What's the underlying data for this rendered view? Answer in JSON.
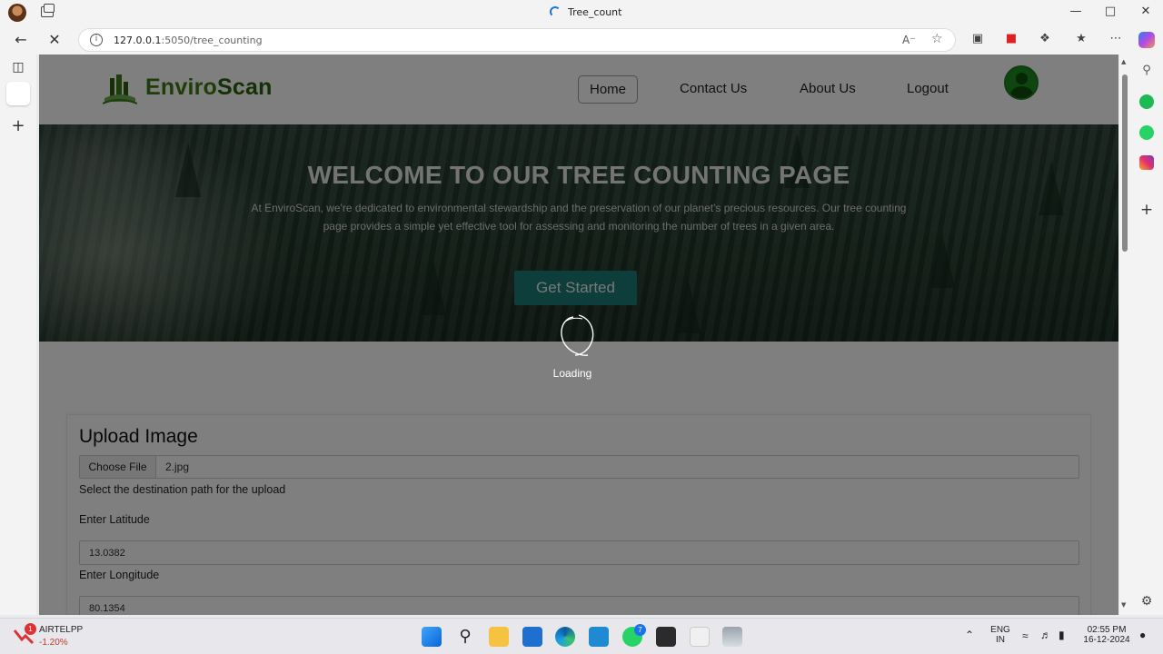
{
  "browser": {
    "tab_title": "Tree_count",
    "url_host": "127.0.0.1",
    "url_path": ":5050/tree_counting",
    "window_controls": [
      "minimize",
      "maximize",
      "close"
    ]
  },
  "site": {
    "logo_part1": "Enviro",
    "logo_part2": "Scan",
    "nav": [
      {
        "label": "Home",
        "active": true
      },
      {
        "label": "Contact Us",
        "active": false
      },
      {
        "label": "About Us",
        "active": false
      },
      {
        "label": "Logout",
        "active": false
      }
    ]
  },
  "hero": {
    "title": "WELCOME TO OUR TREE COUNTING PAGE",
    "text": "At EnviroScan, we're dedicated to environmental stewardship and the preservation of our planet's precious resources. Our tree counting page provides a simple yet effective tool for assessing and monitoring the number of trees in a given area.",
    "cta": "Get Started"
  },
  "overlay": {
    "loading_text": "Loading"
  },
  "upload": {
    "title": "Upload Image",
    "choose_file": "Choose File",
    "file_name": "2.jpg",
    "dest_label": "Select the destination path for the upload",
    "lat_label": "Enter Latitude",
    "lat_value": "13.0382",
    "lon_label": "Enter Longitude",
    "lon_value": "80.1354"
  },
  "taskbar": {
    "stock_name": "AIRTELPP",
    "stock_change": "-1.20%",
    "stock_badge": "1",
    "whatsapp_badge": "7",
    "lang_top": "ENG",
    "lang_bottom": "IN",
    "time": "02:55 PM",
    "date": "16-12-2024"
  },
  "colors": {
    "brand_green": "#3c7a12",
    "cta_teal": "#1c7d77",
    "stock_down": "#c0392b"
  }
}
